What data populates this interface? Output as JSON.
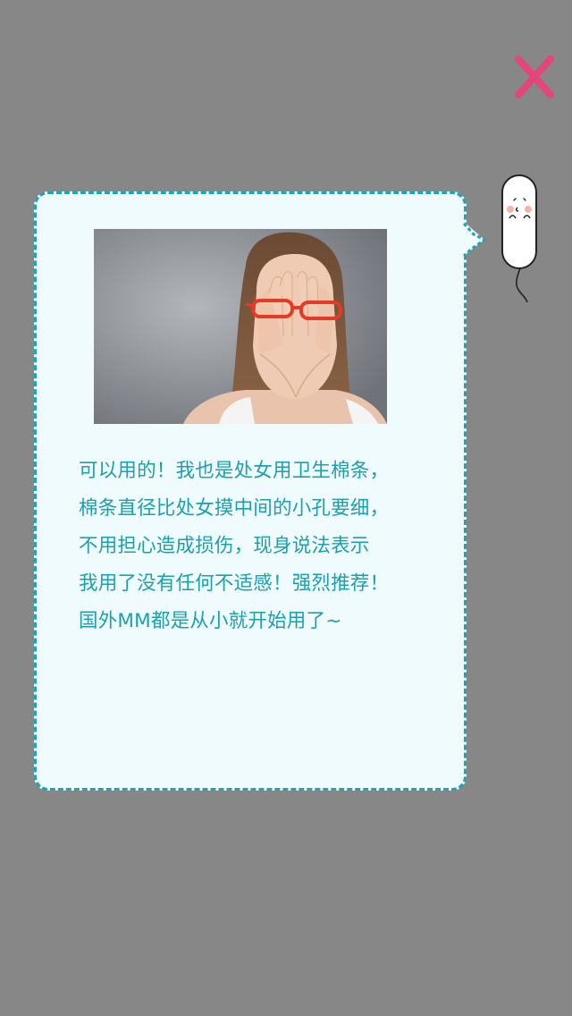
{
  "dialog": {
    "message_lines": [
      "可以用的！我也是处女用卫生棉条，",
      "棉条直径比处女摸中间的小孔要细，",
      "不用担心造成损伤，现身说法表示",
      "我用了没有任何不适感！强烈推荐！",
      "国外MM都是从小就开始用了~"
    ]
  },
  "icons": {
    "close": "close-icon",
    "mascot": "tampon-mascot"
  },
  "colors": {
    "background": "#878787",
    "bubble_fill": "#f0fbfd",
    "bubble_border": "#1aa6b8",
    "text": "#1aa0b0",
    "close": "#e4457a"
  }
}
